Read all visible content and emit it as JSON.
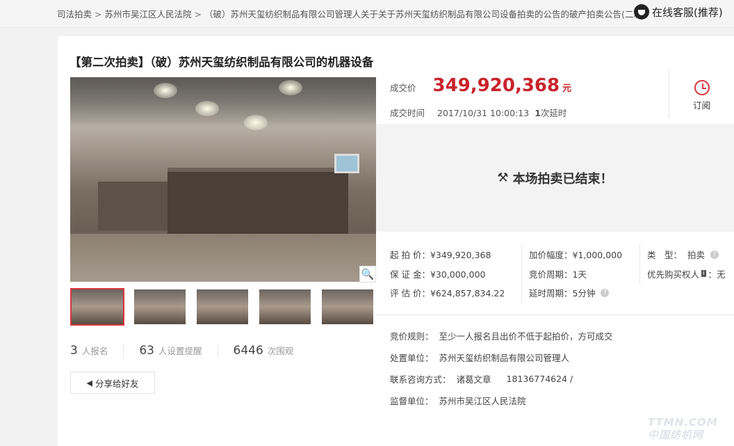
{
  "breadcrumb": [
    "司法拍卖",
    "苏州市吴江区人民法院",
    "（破）苏州天玺纺织制品有限公司管理人关于关于苏州天玺纺织制品有限公司设备拍卖的公告的破产拍卖公告(二次)"
  ],
  "breadcrumb_sep": ">",
  "service_label": "在线客服(推荐)",
  "title": "【第二次拍卖】（破）苏州天玺纺织制品有限公司的机器设备",
  "deal": {
    "price_label": "成交价",
    "price": "349,920,368",
    "unit": "元",
    "time_label": "成交时间",
    "time": "2017/10/31 10:00:13",
    "extend_count": "1",
    "extend_label": "次延时"
  },
  "remind_label": "订阅",
  "ended_text": "本场拍卖已结束！",
  "attrs": {
    "start_price": "起 拍 价：¥349,920,368",
    "deposit": "保 证 金：¥30,000,000",
    "estimate": "评 估 价：¥624,857,834.22",
    "increment": "加价幅度：¥1,000,000",
    "bid_period": "竞价周期：1天",
    "extend_period": "延时周期：5分钟",
    "type_label": "类　型：",
    "type_value": "拍卖",
    "priority_label": "优先购买权人",
    "priority_value": "无"
  },
  "stats": [
    {
      "num": "3",
      "label": "人报名"
    },
    {
      "num": "63",
      "label": "人设置提醒"
    },
    {
      "num": "6446",
      "label": "次围观"
    }
  ],
  "share_label": "分享给好友",
  "info": {
    "rule_label": "竞价规则：",
    "rule": "至少一人报名且出价不低于起拍价，方可成交",
    "unit_label": "处置单位：",
    "unit": "苏州天玺纺织制品有限公司管理人",
    "contact_label": "联系咨询方式：",
    "contact_name": "诸葛文章",
    "contact_phone": "18136774624 /",
    "supervisor_label": "监督单位：",
    "supervisor": "苏州市吴江区人民法院"
  },
  "watermark": [
    "TTMN.COM",
    "中国纺机网"
  ]
}
